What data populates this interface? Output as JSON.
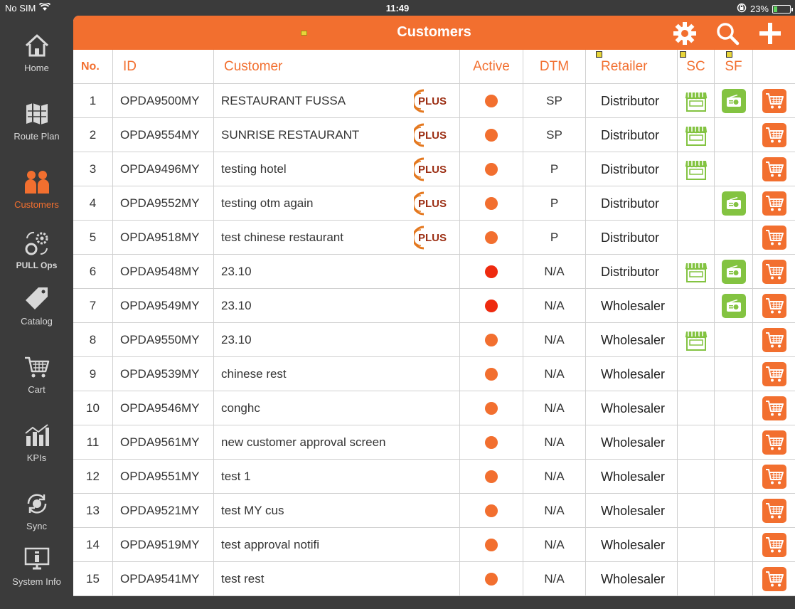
{
  "status_bar": {
    "carrier": "No SIM",
    "time": "11:49",
    "battery_percent": "23%",
    "battery_level": 0.23
  },
  "sidebar": {
    "items": [
      {
        "label": "Home",
        "icon": "home-icon"
      },
      {
        "label": "Route Plan",
        "icon": "map-icon"
      },
      {
        "label": "Customers",
        "icon": "people-icon",
        "active": true
      },
      {
        "label": "PULL Ops",
        "icon": "pull-ops-icon"
      },
      {
        "label": "Catalog",
        "icon": "tag-icon"
      },
      {
        "label": "Cart",
        "icon": "cart-icon"
      },
      {
        "label": "KPIs",
        "icon": "kpi-chart-icon"
      },
      {
        "label": "Sync",
        "icon": "sync-icon"
      },
      {
        "label": "System Info",
        "icon": "system-info-icon"
      }
    ]
  },
  "header": {
    "title": "Customers"
  },
  "colors": {
    "accent": "#f26f2f",
    "active_dot": "#f26f2f",
    "inactive_dot": "#ee2a0f",
    "sf_green": "#83c341",
    "sc_green": "#83c341"
  },
  "table": {
    "columns": [
      "No.",
      "ID",
      "Customer",
      "Active",
      "DTM",
      "Retailer",
      "SC",
      "SF",
      ""
    ],
    "rows": [
      {
        "no": "1",
        "id": "OPDA9500MY",
        "customer": "RESTAURANT FUSSA",
        "plus": true,
        "active": "orange",
        "dtm": "SP",
        "retailer": "Distributor",
        "sc": true,
        "sf": true
      },
      {
        "no": "2",
        "id": "OPDA9554MY",
        "customer": "SUNRISE RESTAURANT",
        "plus": true,
        "active": "orange",
        "dtm": "SP",
        "retailer": "Distributor",
        "sc": true,
        "sf": false
      },
      {
        "no": "3",
        "id": "OPDA9496MY",
        "customer": "testing hotel",
        "plus": true,
        "active": "orange",
        "dtm": "P",
        "retailer": "Distributor",
        "sc": true,
        "sf": false
      },
      {
        "no": "4",
        "id": "OPDA9552MY",
        "customer": "testing otm again",
        "plus": true,
        "active": "orange",
        "dtm": "P",
        "retailer": "Distributor",
        "sc": false,
        "sf": true
      },
      {
        "no": "5",
        "id": "OPDA9518MY",
        "customer": "test chinese restaurant",
        "plus": true,
        "active": "orange",
        "dtm": "P",
        "retailer": "Distributor",
        "sc": false,
        "sf": false
      },
      {
        "no": "6",
        "id": "OPDA9548MY",
        "customer": "23.10",
        "plus": false,
        "active": "red",
        "dtm": "N/A",
        "retailer": "Distributor",
        "sc": true,
        "sf": true
      },
      {
        "no": "7",
        "id": "OPDA9549MY",
        "customer": "23.10",
        "plus": false,
        "active": "red",
        "dtm": "N/A",
        "retailer": "Wholesaler",
        "sc": false,
        "sf": true
      },
      {
        "no": "8",
        "id": "OPDA9550MY",
        "customer": "23.10",
        "plus": false,
        "active": "orange",
        "dtm": "N/A",
        "retailer": "Wholesaler",
        "sc": true,
        "sf": false
      },
      {
        "no": "9",
        "id": "OPDA9539MY",
        "customer": "chinese rest",
        "plus": false,
        "active": "orange",
        "dtm": "N/A",
        "retailer": "Wholesaler",
        "sc": false,
        "sf": false
      },
      {
        "no": "10",
        "id": "OPDA9546MY",
        "customer": "conghc",
        "plus": false,
        "active": "orange",
        "dtm": "N/A",
        "retailer": "Wholesaler",
        "sc": false,
        "sf": false
      },
      {
        "no": "11",
        "id": "OPDA9561MY",
        "customer": "new customer approval screen",
        "plus": false,
        "active": "orange",
        "dtm": "N/A",
        "retailer": "Wholesaler",
        "sc": false,
        "sf": false
      },
      {
        "no": "12",
        "id": "OPDA9551MY",
        "customer": "test 1",
        "plus": false,
        "active": "orange",
        "dtm": "N/A",
        "retailer": "Wholesaler",
        "sc": false,
        "sf": false
      },
      {
        "no": "13",
        "id": "OPDA9521MY",
        "customer": "test MY cus",
        "plus": false,
        "active": "orange",
        "dtm": "N/A",
        "retailer": "Wholesaler",
        "sc": false,
        "sf": false
      },
      {
        "no": "14",
        "id": "OPDA9519MY",
        "customer": "test approval notifi",
        "plus": false,
        "active": "orange",
        "dtm": "N/A",
        "retailer": "Wholesaler",
        "sc": false,
        "sf": false
      },
      {
        "no": "15",
        "id": "OPDA9541MY",
        "customer": "test rest",
        "plus": false,
        "active": "orange",
        "dtm": "N/A",
        "retailer": "Wholesaler",
        "sc": false,
        "sf": false
      }
    ]
  }
}
